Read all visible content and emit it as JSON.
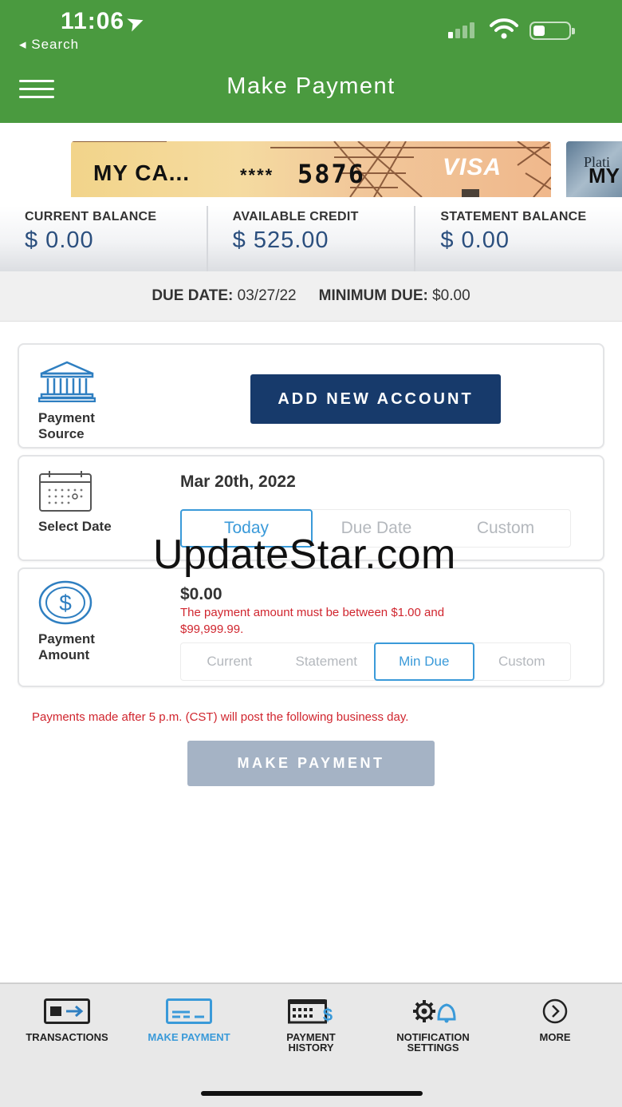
{
  "status_bar": {
    "time": "11:06",
    "back_label": "Search"
  },
  "header": {
    "title": "Make Payment"
  },
  "card": {
    "name": "MY CA...",
    "masked": "****",
    "last4": "5876",
    "network": "VISA"
  },
  "card_peek": {
    "line1": "Plati",
    "line2": "MY"
  },
  "balances": [
    {
      "label": "CURRENT BALANCE",
      "value": "$ 0.00"
    },
    {
      "label": "AVAILABLE CREDIT",
      "value": "$ 525.00"
    },
    {
      "label": "STATEMENT BALANCE",
      "value": "$ 0.00"
    }
  ],
  "due": {
    "due_label": "DUE DATE:",
    "due_value": "03/27/22",
    "min_label": "MINIMUM DUE:",
    "min_value": "$0.00"
  },
  "payment_source": {
    "label_line1": "Payment",
    "label_line2": "Source",
    "add_button": "ADD NEW ACCOUNT"
  },
  "select_date": {
    "label": "Select Date",
    "date": "Mar 20th, 2022",
    "options": [
      "Today",
      "Due Date",
      "Custom"
    ],
    "selected": "Today"
  },
  "payment_amount": {
    "label_line1": "Payment",
    "label_line2": "Amount",
    "amount": "$0.00",
    "error_line1": "The payment amount must be between $1.00 and",
    "error_line2": "$99,999.99.",
    "options": [
      "Current",
      "Statement",
      "Min Due",
      "Custom"
    ],
    "selected": "Min Due"
  },
  "post_note": "Payments made after 5 p.m. (CST) will post the following business day.",
  "make_payment_button": "MAKE PAYMENT",
  "watermark": "UpdateStar.com",
  "tabs": [
    {
      "line1": "TRANSACTIONS",
      "line2": "",
      "icon": "transactions-icon"
    },
    {
      "line1": "MAKE PAYMENT",
      "line2": "",
      "icon": "card-icon",
      "active": true
    },
    {
      "line1": "PAYMENT",
      "line2": "HISTORY",
      "icon": "calendar-dollar-icon"
    },
    {
      "line1": "NOTIFICATION",
      "line2": "SETTINGS",
      "icon": "gear-bell-icon"
    },
    {
      "line1": "MORE",
      "line2": "",
      "icon": "chevron-right-circle-icon"
    }
  ],
  "colors": {
    "header_green": "#4a9a3f",
    "navy_button": "#173a6b",
    "accent_blue": "#3a9ad9",
    "error_red": "#d0252e",
    "balance_blue": "#2b4f7e",
    "disabled_button": "#a5b3c5"
  }
}
